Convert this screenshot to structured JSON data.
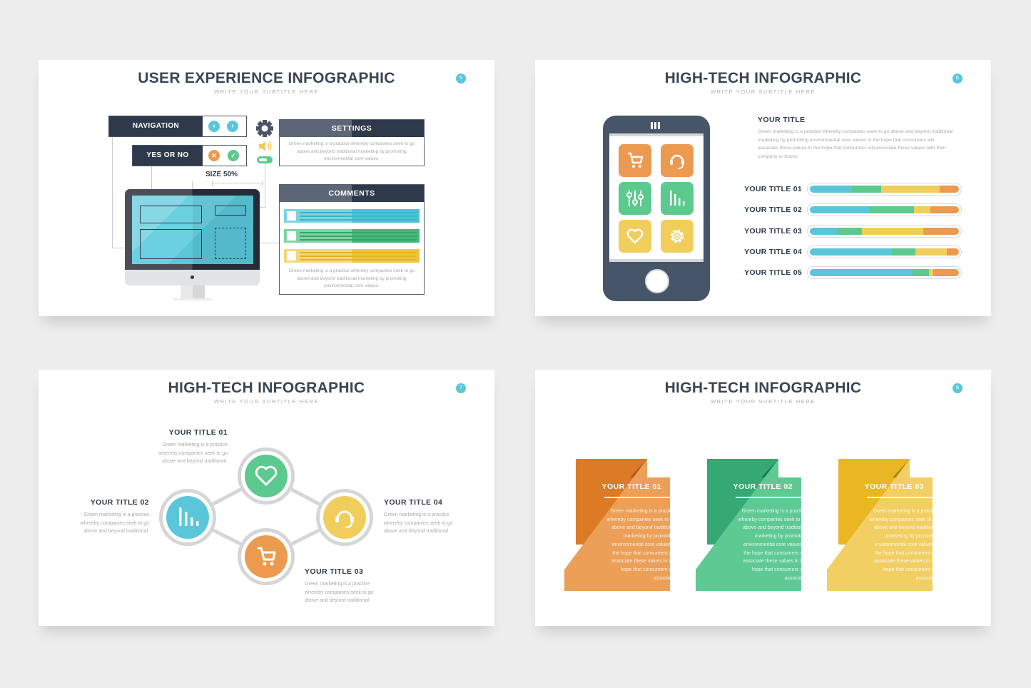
{
  "colors": {
    "background": "#ededed",
    "navy": "#2e3a4c",
    "cyan": "#5bc6d9",
    "green": "#5cc98e",
    "yellow": "#f1cd5c",
    "orange": "#eb9a50",
    "gray_text": "#a5a8ad"
  },
  "slides": [
    {
      "number": "5",
      "title": "USER EXPERIENCE INFOGRAPHIC",
      "subtitle": "WRITE YOUR SUBTITLE HERE",
      "navigation": {
        "label": "NAVIGATION",
        "prev_icon": "chevron-left",
        "next_icon": "chevron-right"
      },
      "yes_or_no": {
        "label": "YES OR NO",
        "no_icon": "x",
        "yes_icon": "check"
      },
      "size_label": "SIZE 50%",
      "side_icons": [
        "gear",
        "speaker",
        "toggle"
      ],
      "settings": {
        "title": "SETTINGS",
        "text": "Green marketing is a practice whereby companies seek to go above and beyond traditional marketing by promoting environmental core values."
      },
      "comments": {
        "title": "COMMENTS",
        "text": "Green marketing is a practice whereby companies seek to go above and beyond traditional marketing by promoting environmental core values.",
        "bar_colors": [
          "#5bc6d9",
          "#5cc98e",
          "#f1cd5c"
        ]
      }
    },
    {
      "number": "6",
      "title": "HIGH-TECH INFOGRAPHIC",
      "subtitle": "WRITE YOUR SUBTITLE HERE",
      "phone_apps": [
        {
          "icon": "cart",
          "color": "#eb9a50"
        },
        {
          "icon": "headset",
          "color": "#eb9a50"
        },
        {
          "icon": "sliders",
          "color": "#5cc98e"
        },
        {
          "icon": "bar-chart",
          "color": "#5cc98e"
        },
        {
          "icon": "heart",
          "color": "#f1cd5c"
        },
        {
          "icon": "gear",
          "color": "#f1cd5c"
        }
      ],
      "heading": "YOUR TITLE",
      "text": "Green marketing is a practice whereby companies seek to go above and beyond traditional marketing by promoting environmental core values in the hope that consumers will associate these values in the hope that consumers will associate these values with their company or brand.",
      "bars": [
        {
          "label": "YOUR TITLE 01",
          "segments_pct": [
            28,
            20,
            39,
            13
          ]
        },
        {
          "label": "YOUR TITLE 02",
          "segments_pct": [
            40,
            30,
            11,
            19
          ]
        },
        {
          "label": "YOUR TITLE 03",
          "segments_pct": [
            18,
            17,
            41,
            24
          ]
        },
        {
          "label": "YOUR TITLE 04",
          "segments_pct": [
            55,
            16,
            21,
            8
          ]
        },
        {
          "label": "YOUR TITLE 05",
          "segments_pct": [
            69,
            11,
            3,
            17
          ]
        }
      ],
      "segment_colors": [
        "#5bc6d9",
        "#5cc98e",
        "#f1cd5c",
        "#eb9a50"
      ]
    },
    {
      "number": "7",
      "title": "HIGH-TECH INFOGRAPHIC",
      "subtitle": "WRITE YOUR SUBTITLE HERE",
      "nodes": [
        {
          "title": "YOUR TITLE 01",
          "icon": "heart",
          "color": "#5cc98e",
          "lines": [
            "Green marketing is a practice",
            "whereby companies seek to go",
            "above and beyond traditional."
          ]
        },
        {
          "title": "YOUR TITLE 02",
          "icon": "bar-chart",
          "color": "#5bc6d9",
          "lines": [
            "Green marketing is a practice",
            "whereby companies seek to go",
            "above and beyond traditional."
          ]
        },
        {
          "title": "YOUR TITLE 03",
          "icon": "cart",
          "color": "#eb9a50",
          "lines": [
            "Green marketing is a practice",
            "whereby companies seek to go",
            "above and beyond traditional."
          ]
        },
        {
          "title": "YOUR TITLE 04",
          "icon": "headset",
          "color": "#f1cd5c",
          "lines": [
            "Green marketing is a practice",
            "whereby companies seek to go",
            "above and beyond traditional."
          ]
        }
      ]
    },
    {
      "number": "8",
      "title": "HIGH-TECH INFOGRAPHIC",
      "subtitle": "WRITE YOUR SUBTITLE HERE",
      "cards": [
        {
          "title": "YOUR TITLE 01",
          "dark": "#dc7a25",
          "shade": "#a85a18",
          "light": "#eb9f57",
          "lines": [
            "Green marketing is a practice",
            "whereby companies seek to go",
            "above and beyond traditional",
            "marketing by promoting",
            "environmental core values in",
            "the hope that consumers will",
            "associate these values in the",
            "hope that consumers will",
            "associate."
          ]
        },
        {
          "title": "YOUR TITLE 02",
          "dark": "#36a874",
          "shade": "#25744f",
          "light": "#5ec993",
          "lines": [
            "Green marketing is a practice",
            "whereby companies seek to go",
            "above and beyond traditional",
            "marketing by promoting",
            "environmental core values in",
            "the hope that consumers will",
            "associate these values in the",
            "hope that consumers will",
            "associate."
          ]
        },
        {
          "title": "YOUR TITLE 03",
          "dark": "#e9b624",
          "shade": "#a7810f",
          "light": "#f1cf63",
          "lines": [
            "Green marketing is a practice",
            "whereby companies seek to go",
            "above and beyond traditional",
            "marketing by promoting",
            "environmental core values in",
            "the hope that consumers will",
            "associate these values in the",
            "hope that consumers will",
            "associate."
          ]
        }
      ]
    }
  ]
}
